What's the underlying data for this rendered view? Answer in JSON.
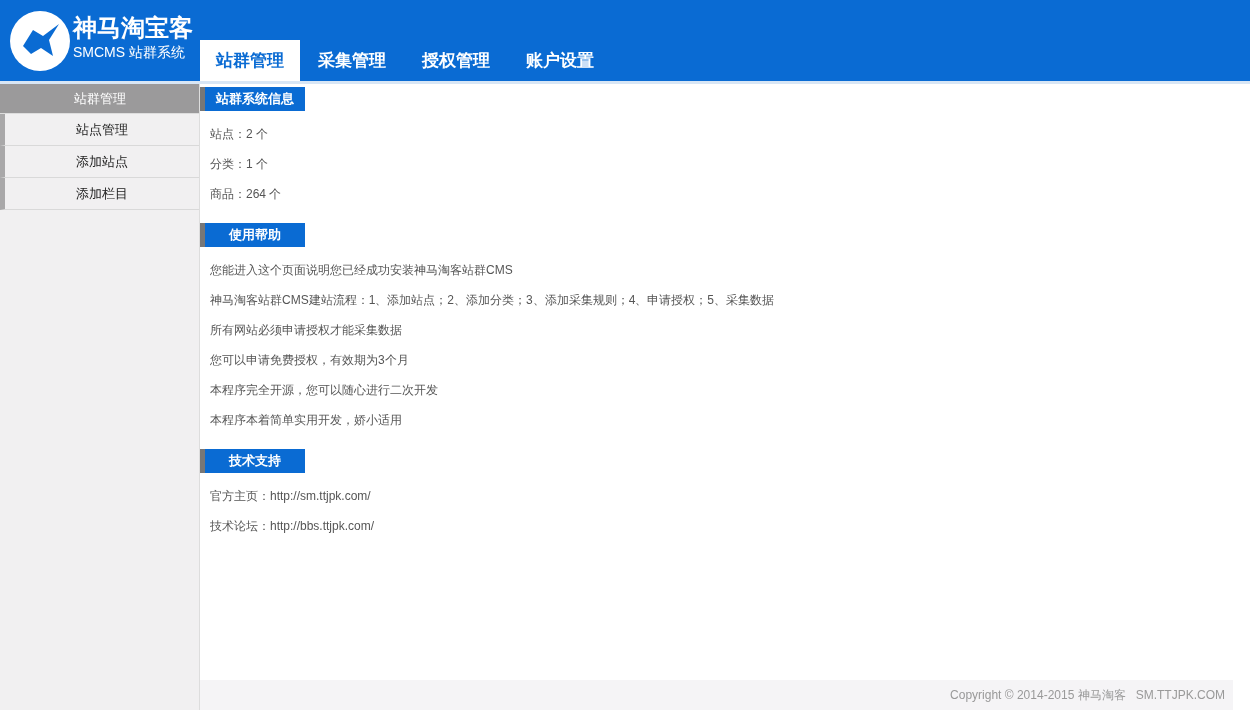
{
  "logo": {
    "title": "神马淘宝客",
    "subtitle": "SMCMS 站群系统"
  },
  "tabs": [
    {
      "label": "站群管理",
      "selected": true
    },
    {
      "label": "采集管理",
      "selected": false
    },
    {
      "label": "授权管理",
      "selected": false
    },
    {
      "label": "账户设置",
      "selected": false
    }
  ],
  "sidebar": {
    "title": "站群管理",
    "items": [
      "站点管理",
      "添加站点",
      "添加栏目"
    ]
  },
  "sections": [
    {
      "title": "站群系统信息",
      "lines": [
        "站点：2 个",
        "分类：1 个",
        "商品：264 个"
      ]
    },
    {
      "title": "使用帮助",
      "lines": [
        "您能进入这个页面说明您已经成功安装神马淘客站群CMS",
        "神马淘客站群CMS建站流程：1、添加站点；2、添加分类；3、添加采集规则；4、申请授权；5、采集数据",
        "所有网站必须申请授权才能采集数据",
        "您可以申请免费授权，有效期为3个月",
        "本程序完全开源，您可以随心进行二次开发",
        "本程序本着简单实用开发，娇小适用"
      ]
    },
    {
      "title": "技术支持",
      "lines": [
        "官方主页：http://sm.ttjpk.com/",
        "技术论坛：http://bbs.ttjpk.com/"
      ]
    }
  ],
  "footer": "Copyright © 2014-2015 神马淘客   SM.TTJPK.COM"
}
